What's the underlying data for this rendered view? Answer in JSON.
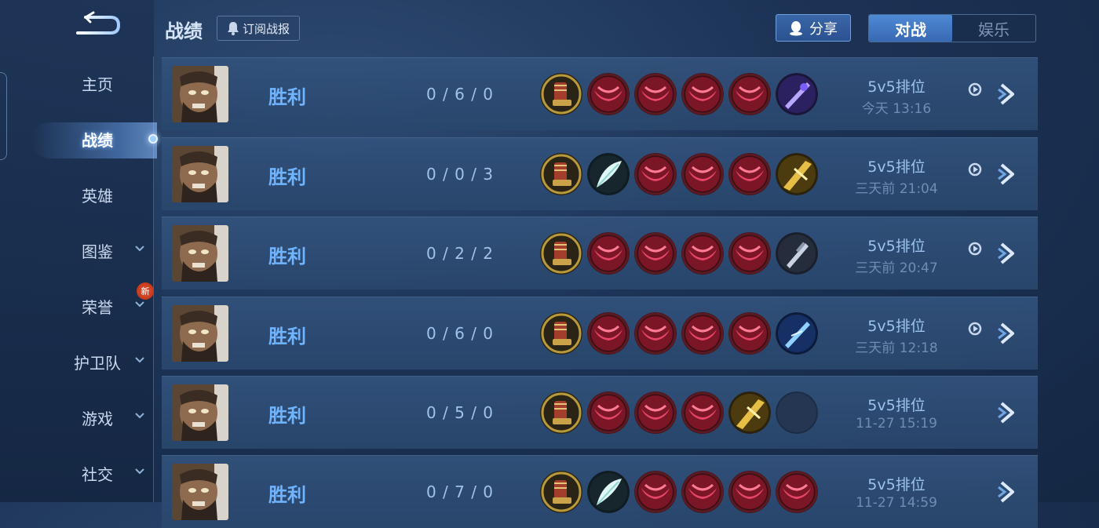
{
  "sidebar": {
    "items": [
      {
        "label": "主页",
        "has_chevron": false
      },
      {
        "label": "战绩",
        "has_chevron": false,
        "active": true
      },
      {
        "label": "英雄",
        "has_chevron": false
      },
      {
        "label": "图鉴",
        "has_chevron": true
      },
      {
        "label": "荣誉",
        "has_chevron": true,
        "badge": "新"
      },
      {
        "label": "护卫队",
        "has_chevron": true
      },
      {
        "label": "游戏",
        "has_chevron": true
      },
      {
        "label": "社交",
        "has_chevron": true
      }
    ]
  },
  "header": {
    "title": "战绩",
    "subscribe_label": "订阅战报",
    "share_label": "分享",
    "tabs": [
      {
        "label": "对战",
        "selected": true
      },
      {
        "label": "娱乐",
        "selected": false
      }
    ]
  },
  "colors": {
    "win": "#6fb4ff",
    "accent": "#3869b3"
  },
  "matches": [
    {
      "result": "胜利",
      "kda": "0 / 6 / 0",
      "mode": "5v5排位",
      "time": "今天 13:16",
      "replay": true,
      "items": [
        "boots-item",
        "red-item",
        "red-item",
        "red-item",
        "red-item",
        "purple-blade-item"
      ]
    },
    {
      "result": "胜利",
      "kda": "0 / 0 / 3",
      "mode": "5v5排位",
      "time": "三天前 21:04",
      "replay": true,
      "items": [
        "boots-item",
        "feather-item",
        "red-item",
        "red-item",
        "red-item",
        "gold-blade-item"
      ]
    },
    {
      "result": "胜利",
      "kda": "0 / 2 / 2",
      "mode": "5v5排位",
      "time": "三天前 20:47",
      "replay": true,
      "items": [
        "boots-item",
        "red-item",
        "red-item",
        "red-item",
        "red-item",
        "silver-sword-item"
      ]
    },
    {
      "result": "胜利",
      "kda": "0 / 6 / 0",
      "mode": "5v5排位",
      "time": "三天前 12:18",
      "replay": true,
      "items": [
        "boots-item",
        "red-item",
        "red-item",
        "red-item",
        "red-item",
        "blue-blade-item"
      ]
    },
    {
      "result": "胜利",
      "kda": "0 / 5 / 0",
      "mode": "5v5排位",
      "time": "11-27  15:19",
      "replay": false,
      "items": [
        "boots-item",
        "red-item",
        "red-item",
        "red-item",
        "gold-blade-item",
        "empty-slot"
      ]
    },
    {
      "result": "胜利",
      "kda": "0 / 7 / 0",
      "mode": "5v5排位",
      "time": "11-27  14:59",
      "replay": false,
      "items": [
        "boots-item",
        "feather-item",
        "red-item",
        "red-item",
        "red-item",
        "red-item"
      ]
    }
  ]
}
